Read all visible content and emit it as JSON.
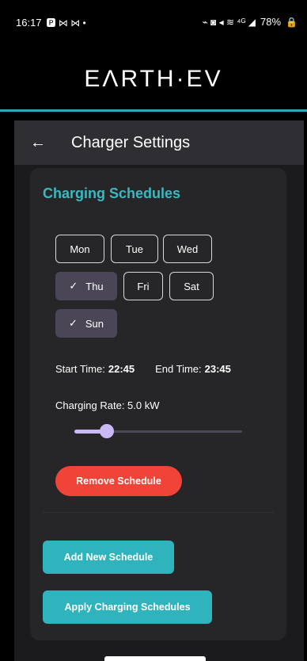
{
  "status_bar": {
    "time": "16:17",
    "left_icons": "🅿 ⋈ ⋈ •",
    "right_icons": "⌁ ◙ ◂ ≋ ⁴ᴳ ◢",
    "battery": "78%"
  },
  "brand": {
    "logo_text": "ΕΛRTH·EV"
  },
  "app_bar": {
    "title": "Charger Settings"
  },
  "schedule": {
    "section_title": "Charging Schedules",
    "days": [
      {
        "label": "Mon",
        "selected": false
      },
      {
        "label": "Tue",
        "selected": false
      },
      {
        "label": "Wed",
        "selected": false
      },
      {
        "label": "Thu",
        "selected": true
      },
      {
        "label": "Fri",
        "selected": false
      },
      {
        "label": "Sat",
        "selected": false
      },
      {
        "label": "Sun",
        "selected": true
      }
    ],
    "start_label": "Start Time:",
    "start_value": "22:45",
    "end_label": "End Time:",
    "end_value": "23:45",
    "rate_label": "Charging Rate: 5.0 kW",
    "rate_value_kw": 5.0,
    "remove_label": "Remove Schedule"
  },
  "actions": {
    "add_label": "Add New Schedule",
    "apply_label": "Apply Charging Schedules"
  },
  "colors": {
    "accent": "#2fb3bc",
    "danger": "#f04438",
    "slider": "#cbb9f5"
  }
}
